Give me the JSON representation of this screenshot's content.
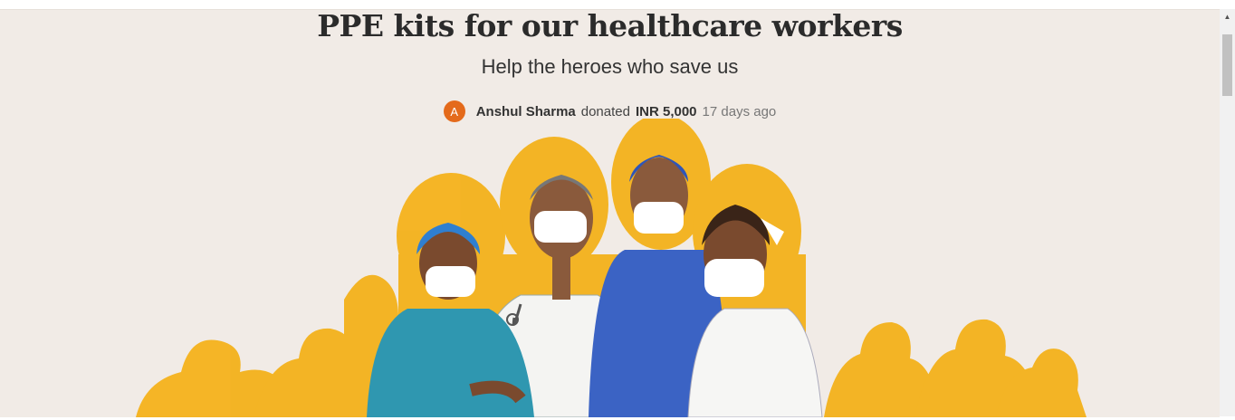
{
  "campaign": {
    "title": "PPE kits for our healthcare workers",
    "subtitle": "Help the heroes who save us"
  },
  "donation": {
    "avatar_initial": "A",
    "donor_name": "Anshul Sharma",
    "verb": "donated",
    "amount": "INR 5,000",
    "time_ago": "17 days ago"
  },
  "colors": {
    "background": "#f1ebe6",
    "illustration_yellow": "#f4b21b",
    "avatar": "#e46a1b"
  },
  "icons": {
    "scroll_up": "▲"
  }
}
